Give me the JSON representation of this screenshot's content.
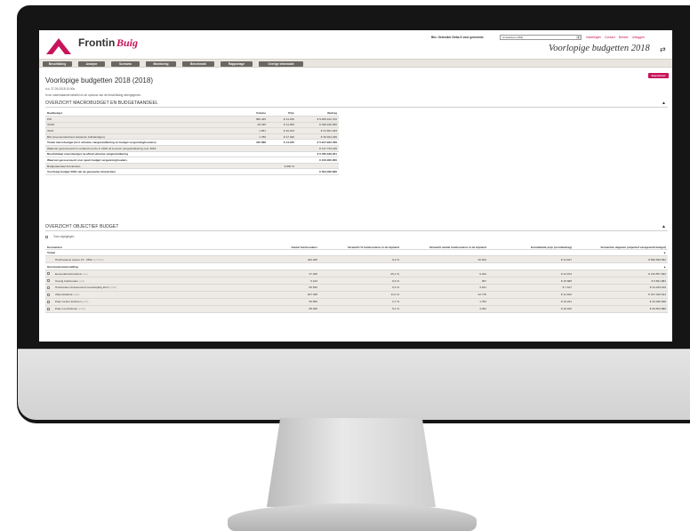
{
  "app": {
    "brand_first": "Frontin",
    "brand_second": "Buig",
    "municipality_label": "Bliz. Gebruiker Delta-G voor gemeente:",
    "municipality_value": "Amsterdam (363)",
    "top_links": [
      "Instellingen",
      "Contact",
      "Beheer",
      "Uitloggen"
    ],
    "page_heading": "Voorlopige budgetten 2018"
  },
  "nav": {
    "tabs": [
      "Beschikking",
      "Analyse",
      "Scenario",
      "Monitoring",
      "Benchmark",
      "Rapportage",
      "Overige informatie"
    ]
  },
  "page": {
    "title": "Voorlopige budgetten 2018 (2018)",
    "date_line": "d.d. 27-09-2018 10:00u",
    "intro": "In de onderstaande tabellen is de opbouw van de beschikking weergegeven.",
    "export_label": "Exporteren"
  },
  "macro": {
    "section_title": "OVERZICHT MACROBUDGET EN BUDGETAANDEEL",
    "headers": [
      "Deelbudget",
      "Volume",
      "Prijs",
      "Bedrag"
    ],
    "rows": [
      {
        "label": "PW",
        "volume": "385.435",
        "price": "€ 14.180",
        "amount": "€ 5.465.102.370"
      },
      {
        "label": "IOAW",
        "volume": "28.335",
        "price": "€ 14.009",
        "amount": "€ 396.918.450"
      },
      {
        "label": "IOAZ",
        "volume": "1.951",
        "price": "€ 16.223",
        "amount": "€ 31.651.433"
      },
      {
        "label": "Bbz (levensonderhoud startende zelfstandigen)",
        "volume": "1.789",
        "price": "€ 17.326",
        "amount": "€ 30.944.236"
      },
      {
        "label": "Totaal macrobudget (incl. uitname vangnetuitkering en budget vergunninghouders)",
        "volume": "415.588",
        "price": "€ 14.245",
        "amount": "€ 5.917.922.458"
      },
      {
        "label": "Waarvan gereserveerd in verband met de in 2019 uit te keren vangnetuitkering over 2018",
        "volume": "",
        "price": "",
        "amount": "€ 137.733.196"
      },
      {
        "label": "Beschikbaar macrobudget na aftrek uitname vangnetuitkering",
        "volume": "",
        "price": "",
        "amount": "€ 5.780.189.261"
      },
      {
        "label": "Waarvan gereserveerd voor apart budget vergunninghouders",
        "volume": "",
        "price": "",
        "amount": "€ 100.000.000"
      },
      {
        "label": "Budgetaandeel Amsterdam",
        "volume": "",
        "price": "9,990 %",
        "amount": ""
      },
      {
        "label": "Voorlopig budget 2018 van de gemeente Amsterdam",
        "volume": "",
        "price": "",
        "amount": "€ 564.496.836"
      }
    ]
  },
  "objective": {
    "section_title": "OVERZICHT OBJECTIEF BUDGET",
    "toggle_label": "Toon wijzigingen",
    "headers": [
      "Kenmerken",
      "Aantal huishoudens",
      "Verwacht % huishoudens in de bijstand",
      "Verwacht aantal huishoudens in de bijstand",
      "Gemiddelde prijs (normbedrag)",
      "Verwachte uitgaven (objectief vastgesteld budget)"
    ],
    "groups": [
      {
        "label": "Totaal",
        "rows": [
          {
            "label": "Huishoudens tussen 15 - 65W",
            "code": "(tot.hhln)",
            "households": "434.400",
            "pct": "9,4 %",
            "expected": "40.944",
            "price": "€ 14.647",
            "spend": "€ 599.699.592"
          }
        ]
      },
      {
        "label": "Huishoudsamenstelling",
        "rows": [
          {
            "label": "Eenoudertuishoudens",
            "code": "(eo)",
            "households": "37.245",
            "pct": "25,1 %",
            "expected": "9.343",
            "price": "€ 13.974",
            "spend": "€ 130.557.842"
          },
          {
            "label": "Overig huishouden",
            "code": "(ovt)",
            "households": "5.193",
            "pct": "6,9 %",
            "expected": "357",
            "price": "€ 15.585",
            "spend": "€ 5.561.884"
          },
          {
            "label": "Huishouden thuiswonend meerderjarig kind",
            "code": "(tmkd)",
            "households": "50.529",
            "pct": "6,3 %",
            "expected": "3.181",
            "price": "€ 7.617",
            "spend": "€ 24.229.619"
          },
          {
            "label": "Alleenstaande",
            "code": "(alst)",
            "households": "207.338",
            "pct": "11,0 %",
            "expected": "22.778",
            "price": "€ 14.810",
            "spend": "€ 337.340.544"
          },
          {
            "label": "Paar zonder kinderen",
            "code": "(pzk)",
            "households": "65.655",
            "pct": "2,7 %",
            "expected": "1.784",
            "price": "€ 19.221",
            "spend": "€ 34.290.608"
          },
          {
            "label": "Paar met kinderen",
            "code": "(pmk)",
            "households": "68.499",
            "pct": "5,1 %",
            "expected": "3.491",
            "price": "€ 19.910",
            "spend": "€ 69.503.886"
          }
        ]
      }
    ]
  }
}
